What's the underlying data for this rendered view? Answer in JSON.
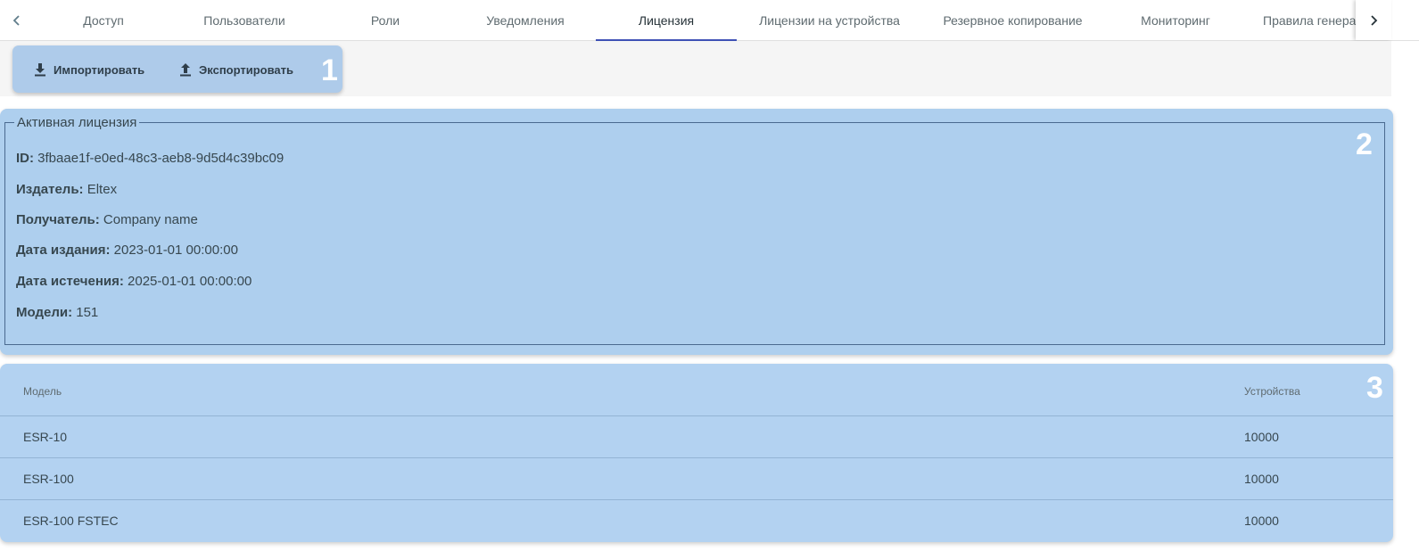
{
  "tabs": [
    {
      "label": "Доступ",
      "active": false
    },
    {
      "label": "Пользователи",
      "active": false
    },
    {
      "label": "Роли",
      "active": false
    },
    {
      "label": "Уведомления",
      "active": false
    },
    {
      "label": "Лицензия",
      "active": true
    },
    {
      "label": "Лицензии на устройства",
      "active": false
    },
    {
      "label": "Резервное копирование",
      "active": false
    },
    {
      "label": "Мониторинг",
      "active": false
    },
    {
      "label": "Правила генера",
      "active": false
    }
  ],
  "tab_nav": {
    "prev_icon": "chevron-left-icon",
    "next_icon": "chevron-right-icon"
  },
  "toolbar": {
    "import_label": "Импортировать",
    "export_label": "Экспортировать",
    "import_icon": "download-icon",
    "export_icon": "upload-icon"
  },
  "markers": {
    "toolbar": "1",
    "license": "2",
    "table": "3"
  },
  "license": {
    "legend": "Активная лицензия",
    "fields": [
      {
        "label": "ID:",
        "value": "3fbaae1f-e0ed-48c3-aeb8-9d5d4c39bc09"
      },
      {
        "label": "Издатель:",
        "value": "Eltex"
      },
      {
        "label": "Получатель:",
        "value": "Company name"
      },
      {
        "label": "Дата издания:",
        "value": "2023-01-01 00:00:00"
      },
      {
        "label": "Дата истечения:",
        "value": "2025-01-01 00:00:00"
      },
      {
        "label": "Модели:",
        "value": "151"
      }
    ]
  },
  "models_table": {
    "columns": [
      "Модель",
      "Устройства"
    ],
    "rows": [
      {
        "model": "ESR-10",
        "devices": "10000"
      },
      {
        "model": "ESR-100",
        "devices": "10000"
      },
      {
        "model": "ESR-100 FSTEC",
        "devices": "10000"
      }
    ]
  },
  "colors": {
    "highlight": "#aecfee",
    "active_tab_indicator": "#3f51b5"
  }
}
